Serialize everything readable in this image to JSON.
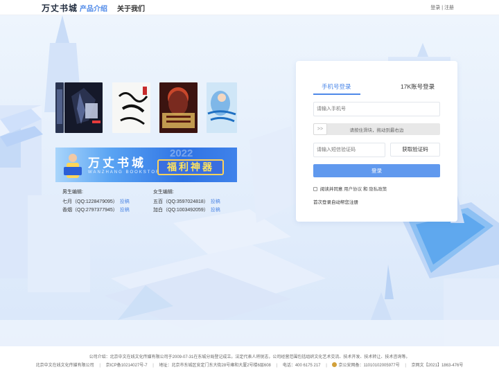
{
  "header": {
    "logo": "万丈书城",
    "nav": [
      "产品介绍",
      "关于我们"
    ],
    "login": "登录",
    "divider": "|",
    "register": "注册"
  },
  "books": [
    {
      "name": "book-cover-1"
    },
    {
      "name": "book-cover-2",
      "title": "江山帝铲"
    },
    {
      "name": "book-cover-3",
      "title": "陆少的冷情前妻"
    },
    {
      "name": "book-cover-4",
      "title": "少年青"
    }
  ],
  "banner": {
    "title": "万丈书城",
    "subtitle": "WANZHANG BOOKSTORE",
    "pill": "福利神器",
    "year": "2022"
  },
  "editors": {
    "male_heading": "男生编辑:",
    "female_heading": "女生编辑:",
    "male": [
      {
        "text": "七月（QQ:1228479095）",
        "link": "投稿"
      },
      {
        "text": "香烟（QQ:2797377945）",
        "link": "投稿"
      }
    ],
    "female": [
      {
        "text": "五百（QQ:3597024818）",
        "link": "投稿"
      },
      {
        "text": "加白（QQ:1003492059）",
        "link": "投稿"
      }
    ]
  },
  "login": {
    "tab_phone": "手机号登录",
    "tab_17k": "17K账号登录",
    "phone_placeholder": "请输入手机号",
    "slider_handle": ">>",
    "slider_text": "请按住滑块，拖动到最右边",
    "sms_placeholder": "请输入短信验证码",
    "code_button": "获取验证码",
    "login_button": "登录",
    "agree_prefix": "阅读并同意",
    "user_agreement": "用户协议",
    "and": "和",
    "privacy": "隐私政策",
    "note": "首次登录自动帮您注册"
  },
  "footer": {
    "line1": "公司介绍：北京中文在线文化传媒有限公司于2009-07-31在东城分局登记成立。法定代表人将锐志，公司经营范围包括组织文化艺术交流、技术开发、技术转让、技术咨询等。",
    "company": "北京中文在线文化传媒有限公司",
    "icp": "京ICP备10214027号-7",
    "address": "地址：北京市东城区安定门东大街28号雍和大厦2号楼6层608",
    "phone": "电话：400 6175 217",
    "police": "京公安网备：11010102005977号",
    "netculture": "京网文【2021】1863-476号",
    "sep": "|"
  },
  "colors": {
    "accent": "#4d88e8",
    "button": "#6099ee",
    "link": "#5a8fe6"
  }
}
